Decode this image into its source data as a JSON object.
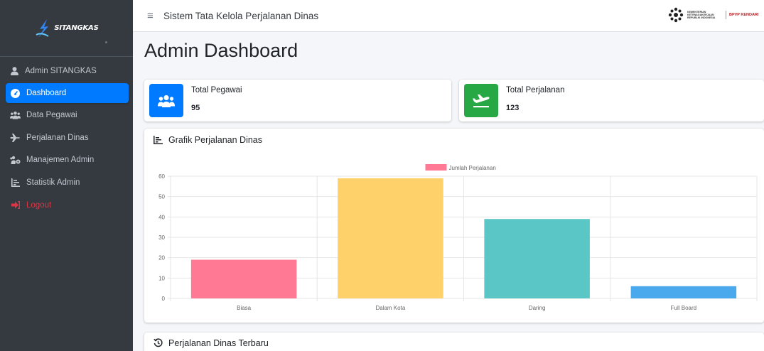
{
  "brand": {
    "name": "SITANGKAS"
  },
  "user": {
    "name": "Admin SITANGKAS"
  },
  "nav": [
    {
      "label": "Dashboard",
      "icon": "tachometer-icon",
      "active": true
    },
    {
      "label": "Data Pegawai",
      "icon": "users-icon"
    },
    {
      "label": "Perjalanan Dinas",
      "icon": "plane-icon"
    },
    {
      "label": "Manajemen Admin",
      "icon": "users-cog-icon"
    },
    {
      "label": "Statistik Admin",
      "icon": "chart-bar-icon"
    },
    {
      "label": "Logout",
      "icon": "sign-out-icon"
    }
  ],
  "header": {
    "title": "Sistem Tata Kelola Perjalanan Dinas",
    "ministry": "KEMENTERIAN KETENAGAKERJAAN REPUBLIK INDONESIA",
    "unit": "BPVP KENDARI"
  },
  "page_title": "Admin Dashboard",
  "stats": [
    {
      "label": "Total Pegawai",
      "value": "95",
      "color": "#007bff",
      "icon": "users-icon"
    },
    {
      "label": "Total Perjalanan",
      "value": "123",
      "color": "#28a745",
      "icon": "plane-departure-icon"
    }
  ],
  "chart_card": {
    "title": "Grafik Perjalanan Dinas"
  },
  "recent_card": {
    "title": "Perjalanan Dinas Terbaru"
  },
  "chart_data": {
    "type": "bar",
    "categories": [
      "Biasa",
      "Dalam Kota",
      "Daring",
      "Full Board"
    ],
    "series": [
      {
        "name": "Jumlah Perjalanan",
        "values": [
          19,
          59,
          39,
          6
        ]
      }
    ],
    "colors": [
      "#ff7894",
      "#ffd16a",
      "#5bc6c6",
      "#4aa8ec"
    ],
    "legend_color": "#ff7894",
    "ylim": [
      0,
      60
    ],
    "yticks": [
      0,
      10,
      20,
      30,
      40,
      50,
      60
    ],
    "legend": "top-center",
    "grid": true
  }
}
